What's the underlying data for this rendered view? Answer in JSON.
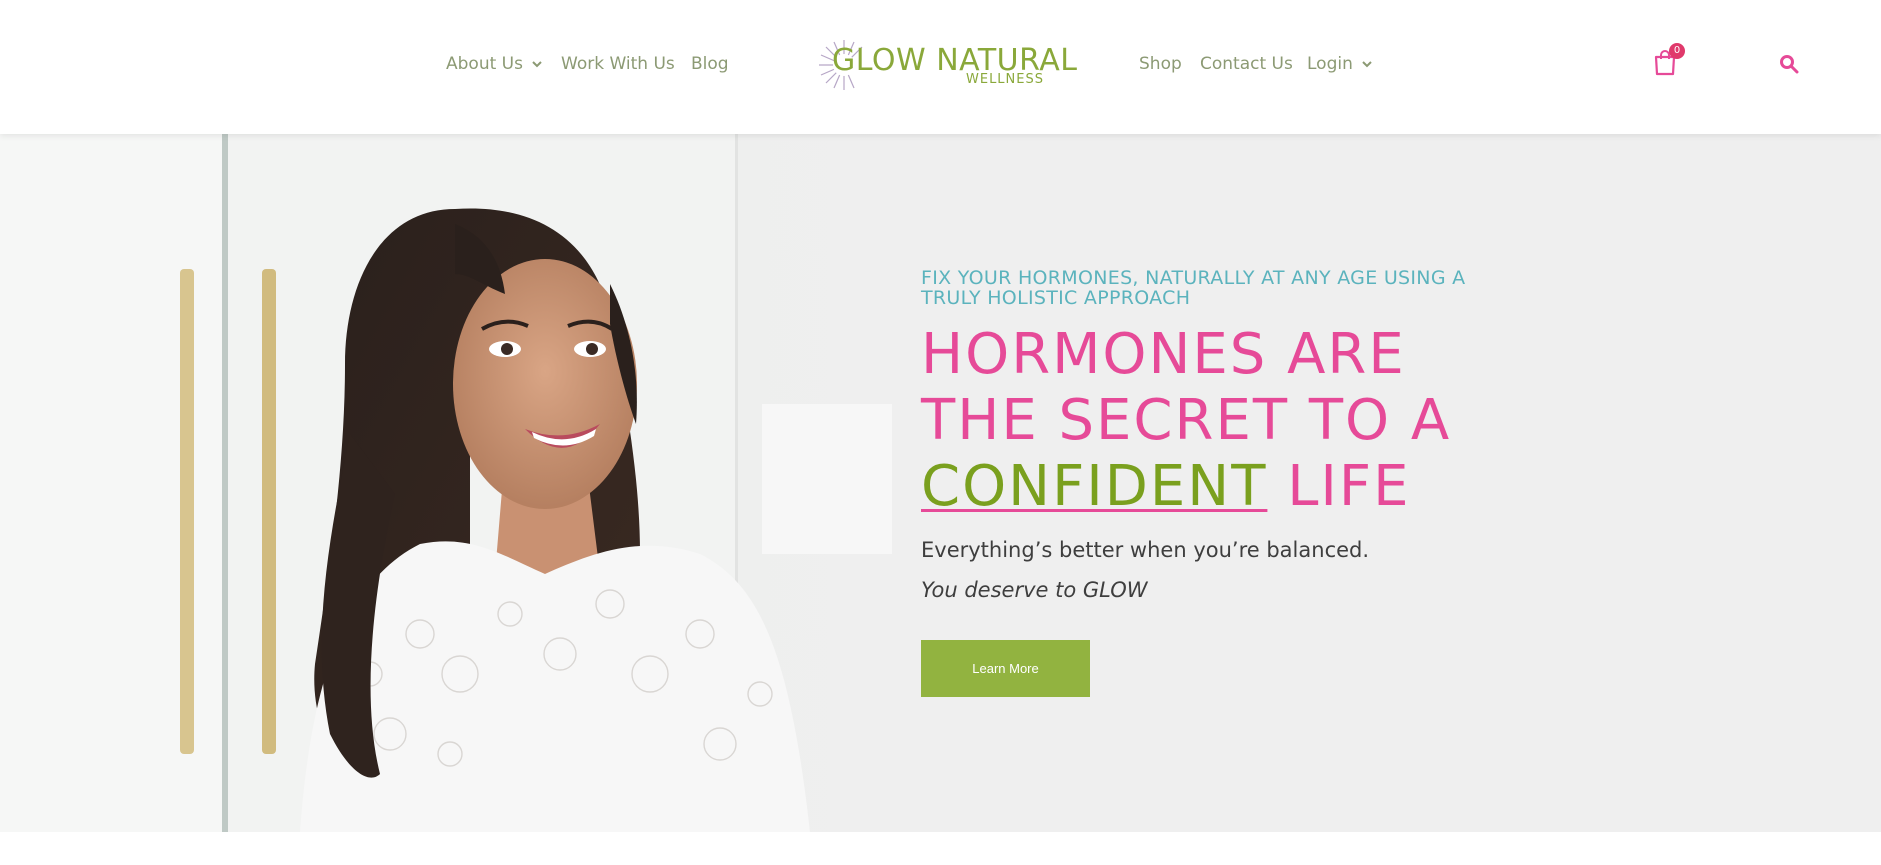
{
  "nav": {
    "left": [
      {
        "label": "About Us",
        "has_dropdown": true
      },
      {
        "label": "Work With Us",
        "has_dropdown": false
      },
      {
        "label": "Blog",
        "has_dropdown": false
      }
    ],
    "right": [
      {
        "label": "Shop",
        "has_dropdown": false
      },
      {
        "label": "Contact Us",
        "has_dropdown": false
      },
      {
        "label": "Login",
        "has_dropdown": true
      }
    ]
  },
  "logo": {
    "main": "GLOW NATURAL",
    "sub": "WELLNESS"
  },
  "cart": {
    "count": "0",
    "icon": "shopping-bag-icon"
  },
  "search": {
    "icon": "search-icon"
  },
  "hero": {
    "eyebrow": "FIX YOUR HORMONES, NATURALLY AT ANY AGE USING A TRULY HOLISTIC APPROACH",
    "headline_line1": "HORMONES ARE",
    "headline_line2": "THE SECRET TO A",
    "headline_accent": "CONFIDENT",
    "headline_end": " LIFE",
    "tagline": "Everything’s better when you’re balanced.",
    "tagline_italic": "You deserve to GLOW",
    "cta_label": "Learn More"
  },
  "colors": {
    "nav_text": "#8c9a74",
    "brand_green": "#8aa83a",
    "accent_pink": "#e64a98",
    "accent_teal": "#5bb3bd",
    "cta_green": "#92b340",
    "badge_red": "#e0396b",
    "hero_bg": "#efefef"
  }
}
